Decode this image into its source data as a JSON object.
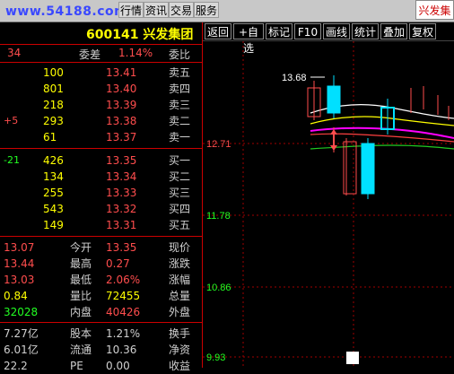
{
  "topbar": {
    "watermark": "www.54188.com",
    "buttons": [
      "行情",
      "资讯",
      "交易",
      "服务"
    ],
    "window_title": "兴发集团"
  },
  "toolbar": {
    "buttons": [
      "返回",
      "+自选",
      "标记",
      "F10",
      "画线",
      "统计",
      "叠加",
      "复权"
    ]
  },
  "stock": {
    "code_name": "600141 兴发集团",
    "ratio_label": "委比",
    "ratio_value": "1.14%",
    "diff_label": "委差",
    "diff_value": "34"
  },
  "asks": [
    {
      "label": "卖五",
      "price": "13.41",
      "vol": "100",
      "chg": ""
    },
    {
      "label": "卖四",
      "price": "13.40",
      "vol": "801",
      "chg": ""
    },
    {
      "label": "卖三",
      "price": "13.39",
      "vol": "218",
      "chg": ""
    },
    {
      "label": "卖二",
      "price": "13.38",
      "vol": "293",
      "chg": "+5"
    },
    {
      "label": "卖一",
      "price": "13.37",
      "vol": "61",
      "chg": ""
    }
  ],
  "bids": [
    {
      "label": "买一",
      "price": "13.35",
      "vol": "426",
      "chg": "-21"
    },
    {
      "label": "买二",
      "price": "13.34",
      "vol": "134",
      "chg": ""
    },
    {
      "label": "买三",
      "price": "13.33",
      "vol": "255",
      "chg": ""
    },
    {
      "label": "买四",
      "price": "13.32",
      "vol": "543",
      "chg": ""
    },
    {
      "label": "买五",
      "price": "13.31",
      "vol": "149",
      "chg": ""
    }
  ],
  "quote": [
    {
      "l1": "现价",
      "v1": "13.35",
      "l2": "今开",
      "v2": "13.07"
    },
    {
      "l1": "涨跌",
      "v1": "0.27",
      "l2": "最高",
      "v2": "13.44"
    },
    {
      "l1": "涨幅",
      "v1": "2.06%",
      "l2": "最低",
      "v2": "13.03"
    },
    {
      "l1": "总量",
      "v1": "72455",
      "l2": "量比",
      "v2": "0.84"
    },
    {
      "l1": "外盘",
      "v1": "40426",
      "l2": "内盘",
      "v2": "32028"
    }
  ],
  "quote_extra": [
    {
      "l1": "换手",
      "v1": "1.21%",
      "l2": "股本",
      "v2": "7.27亿"
    },
    {
      "l1": "净资",
      "v1": "10.36",
      "l2": "流通",
      "v2": "6.01亿"
    },
    {
      "l1": "收益",
      "v1": "0.00",
      "l2": "PE",
      "v2": "22.2"
    }
  ],
  "chart_data": {
    "type": "candlestick",
    "y_ticks": [
      "12.71",
      "11.78",
      "10.86",
      "9.93"
    ],
    "high_label": "13.68",
    "candles": [
      {
        "open": 13.05,
        "close": 13.35,
        "high": 13.45,
        "low": 12.95,
        "up": true
      },
      {
        "open": 13.6,
        "close": 13.25,
        "high": 13.7,
        "low": 13.2,
        "up": false
      },
      {
        "open": 12.6,
        "close": 12.25,
        "high": 12.7,
        "low": 12.2,
        "up": true
      },
      {
        "open": 12.5,
        "close": 11.7,
        "high": 12.55,
        "low": 11.6,
        "up": false
      },
      {
        "open": 13.3,
        "close": 13.45,
        "high": 13.55,
        "low": 13.1,
        "up": false
      }
    ],
    "current_line": "12.71"
  },
  "colors": {
    "up": "#ff4d4d",
    "down": "#00e0ff",
    "grid": "#c00000"
  }
}
